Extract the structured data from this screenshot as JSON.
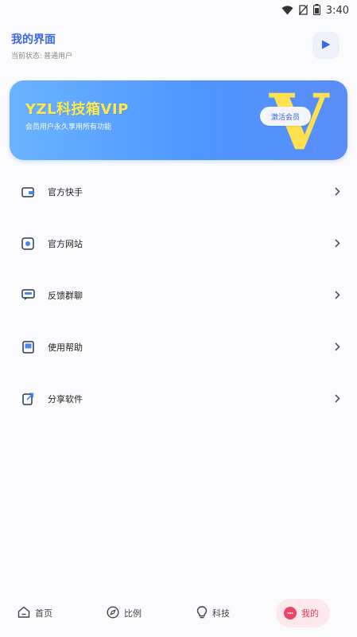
{
  "status_bar": {
    "time": "3:40"
  },
  "header": {
    "title": "我的界面",
    "status_label": "当前状态:",
    "status_value": "普通用户"
  },
  "vip_card": {
    "title": "YZL科技箱VIP",
    "subtitle": "会员用户永久享用所有功能",
    "button_label": "激活会员",
    "badge_letter": "V"
  },
  "menu": {
    "items": [
      {
        "label": "官方快手",
        "icon": "wallet-icon"
      },
      {
        "label": "官方网站",
        "icon": "browser-icon"
      },
      {
        "label": "反馈群聊",
        "icon": "chat-icon"
      },
      {
        "label": "使用帮助",
        "icon": "book-icon"
      },
      {
        "label": "分享软件",
        "icon": "share-icon"
      }
    ]
  },
  "tabbar": {
    "tabs": [
      {
        "label": "首页",
        "icon": "home-icon"
      },
      {
        "label": "比例",
        "icon": "compass-icon"
      },
      {
        "label": "科技",
        "icon": "bulb-icon"
      },
      {
        "label": "我的",
        "icon": "profile-icon",
        "active": true
      }
    ]
  },
  "colors": {
    "accent": "#3a66e8",
    "vip_title": "#ffe84a",
    "active_tab": "#e8395a"
  }
}
